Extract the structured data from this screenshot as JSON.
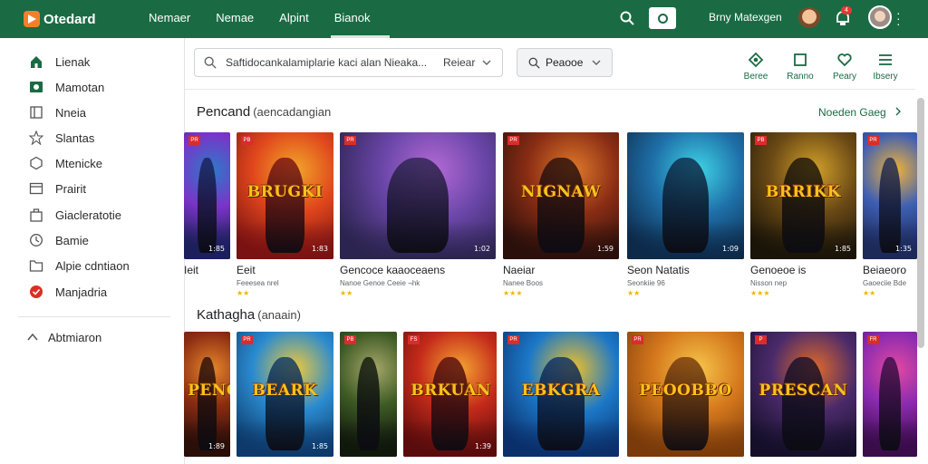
{
  "app": {
    "name": "Otedard"
  },
  "nav": [
    {
      "label": "Nemaer",
      "active": false
    },
    {
      "label": "Nemae",
      "active": false
    },
    {
      "label": "Alpint",
      "active": false
    },
    {
      "label": "Bianok",
      "active": true
    }
  ],
  "topbar": {
    "user_label": "Brny Matexgen",
    "notification_count": "4",
    "icons": [
      "search-icon",
      "record-icon",
      "avatar",
      "notification-icon",
      "avatar",
      "more-icon"
    ]
  },
  "sidebar": {
    "items": [
      {
        "label": "Lienak",
        "icon": "home-icon",
        "color": "#1a6b43"
      },
      {
        "label": "Mamotan",
        "icon": "media-icon",
        "color": "#1a6b43"
      },
      {
        "label": "Nneia",
        "icon": "book-icon",
        "color": "#555555"
      },
      {
        "label": "Slantas",
        "icon": "star-icon",
        "color": "#555555"
      },
      {
        "label": "Mtenicke",
        "icon": "hexagon-icon",
        "color": "#555555"
      },
      {
        "label": "Prairit",
        "icon": "window-icon",
        "color": "#555555"
      },
      {
        "label": "Giacleratotie",
        "icon": "bag-icon",
        "color": "#555555"
      },
      {
        "label": "Bamie",
        "icon": "clock-icon",
        "color": "#555555"
      },
      {
        "label": "Alpie cdntiaon",
        "icon": "folder-icon",
        "color": "#555555"
      },
      {
        "label": "Manjadria",
        "icon": "badge-icon",
        "color": "#d93025"
      }
    ],
    "footer": {
      "label": "Abtmiaron",
      "icon": "collapse-icon"
    }
  },
  "search": {
    "placeholder": "Saftidocankalamiplarie kaci alan Nieaka...",
    "scope": "Reiear"
  },
  "filter": {
    "label": "Peaooe"
  },
  "actions": [
    {
      "label": "Beree",
      "icon": "grid-icon"
    },
    {
      "label": "Ranno",
      "icon": "square-icon"
    },
    {
      "label": "Peary",
      "icon": "heart-icon"
    },
    {
      "label": "Ibsery",
      "icon": "list-icon"
    }
  ],
  "sections": [
    {
      "title": "Pencand",
      "subtitle": "(aencadangian",
      "link": "Noeden Gaeg",
      "cards": [
        {
          "name": "Ieit",
          "sub": "",
          "stars": "",
          "rating": "1:85",
          "art_title": "",
          "palette": [
            "#1b1f5a",
            "#7a34c8",
            "#2c7ac9"
          ],
          "tag": "PR"
        },
        {
          "name": "Eeit",
          "sub": "Feeesea nrel",
          "stars": "★★",
          "rating": "1:83",
          "art_title": "BRUGKI",
          "palette": [
            "#7b1212",
            "#e0461c",
            "#f2a72a"
          ],
          "tag": "PB"
        },
        {
          "name": "Gencoce kaaoceaens",
          "sub": "Nanoe Genoe Ceeie ¬hk",
          "stars": "★★",
          "rating": "1:02",
          "art_title": "",
          "palette": [
            "#2c2450",
            "#6a46a8",
            "#b56ad6"
          ],
          "tag": "PR"
        },
        {
          "name": "Naeiar",
          "sub": "Nanee Boos",
          "stars": "★★★",
          "rating": "1:59",
          "art_title": "NIGNAW",
          "palette": [
            "#2a0f0b",
            "#8a2d14",
            "#e07a2b"
          ],
          "tag": "PR"
        },
        {
          "name": "Seon Natatis",
          "sub": "Seonkiie 96",
          "stars": "★★",
          "rating": "1:09",
          "art_title": "",
          "palette": [
            "#0d2a4a",
            "#1e6fa8",
            "#3fd4e6"
          ],
          "tag": ""
        },
        {
          "name": "Genoeoe is",
          "sub": "Nisson nep",
          "stars": "★★★",
          "rating": "1:85",
          "art_title": "BRRIKK",
          "palette": [
            "#1a1408",
            "#6b4a15",
            "#d4a12a"
          ],
          "tag": "PB"
        },
        {
          "name": "Beiaeoro",
          "sub": "Gaoeciie Bde",
          "stars": "★★",
          "rating": "1:35",
          "art_title": "",
          "palette": [
            "#1c2a5a",
            "#3e5fb3",
            "#f0b23a"
          ],
          "tag": "PR"
        }
      ]
    },
    {
      "title": "Kathagha",
      "subtitle": "(anaain)",
      "link": "",
      "cards": [
        {
          "name": "",
          "sub": "",
          "stars": "",
          "rating": "1:89",
          "art_title": "PENGHR",
          "palette": [
            "#2a0e08",
            "#8c2c12",
            "#e7872b"
          ],
          "tag": ""
        },
        {
          "name": "",
          "sub": "",
          "stars": "",
          "rating": "1:85",
          "art_title": "BEARK",
          "palette": [
            "#0d3a6b",
            "#2a8bd0",
            "#f0c93a"
          ],
          "tag": "PR"
        },
        {
          "name": "",
          "sub": "",
          "stars": "",
          "rating": "",
          "art_title": "",
          "palette": [
            "#10180c",
            "#3d5a24",
            "#a7a86a"
          ],
          "tag": "PB"
        },
        {
          "name": "",
          "sub": "",
          "stars": "",
          "rating": "1:39",
          "art_title": "BRKUAN",
          "palette": [
            "#5a0c0c",
            "#c42a1a",
            "#f6a532"
          ],
          "tag": "FS"
        },
        {
          "name": "",
          "sub": "",
          "stars": "",
          "rating": "",
          "art_title": "EBKGRA",
          "palette": [
            "#0a2f6a",
            "#1c78c8",
            "#f2c128"
          ],
          "tag": "PR"
        },
        {
          "name": "",
          "sub": "",
          "stars": "",
          "rating": "",
          "art_title": "PEOOBBO",
          "palette": [
            "#7a3a0a",
            "#d4771c",
            "#f7c64a"
          ],
          "tag": "PR"
        },
        {
          "name": "",
          "sub": "",
          "stars": "",
          "rating": "",
          "art_title": "PRESCAN",
          "palette": [
            "#150f2a",
            "#4a2a6a",
            "#e26a2a"
          ],
          "tag": "P"
        },
        {
          "name": "",
          "sub": "",
          "stars": "",
          "rating": "",
          "art_title": "",
          "palette": [
            "#3a0c4a",
            "#8a2ab0",
            "#e24aa0"
          ],
          "tag": "FR"
        }
      ]
    }
  ],
  "colors": {
    "brand": "#1a6b43",
    "accent": "#f47f2a",
    "star": "#f4b400"
  }
}
